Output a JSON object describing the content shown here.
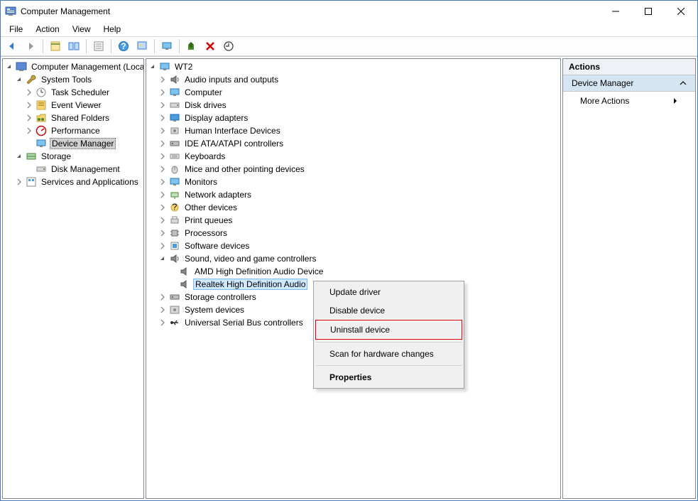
{
  "window": {
    "title": "Computer Management"
  },
  "menubar": [
    "File",
    "Action",
    "View",
    "Help"
  ],
  "nav_tree": {
    "root": "Computer Management (Local)",
    "system_tools": {
      "label": "System Tools",
      "children": [
        "Task Scheduler",
        "Event Viewer",
        "Shared Folders",
        "Performance",
        "Device Manager"
      ]
    },
    "storage": {
      "label": "Storage",
      "children": [
        "Disk Management"
      ]
    },
    "services": "Services and Applications"
  },
  "device_tree": {
    "root": "WT2",
    "categories": [
      "Audio inputs and outputs",
      "Computer",
      "Disk drives",
      "Display adapters",
      "Human Interface Devices",
      "IDE ATA/ATAPI controllers",
      "Keyboards",
      "Mice and other pointing devices",
      "Monitors",
      "Network adapters",
      "Other devices",
      "Print queues",
      "Processors",
      "Software devices"
    ],
    "sound": {
      "label": "Sound, video and game controllers",
      "children": [
        "AMD High Definition Audio Device",
        "Realtek High Definition Audio"
      ]
    },
    "after": [
      "Storage controllers",
      "System devices",
      "Universal Serial Bus controllers"
    ]
  },
  "context_menu": {
    "items": [
      "Update driver",
      "Disable device",
      "Uninstall device",
      "Scan for hardware changes",
      "Properties"
    ]
  },
  "actions": {
    "header": "Actions",
    "section": "Device Manager",
    "more": "More Actions"
  }
}
